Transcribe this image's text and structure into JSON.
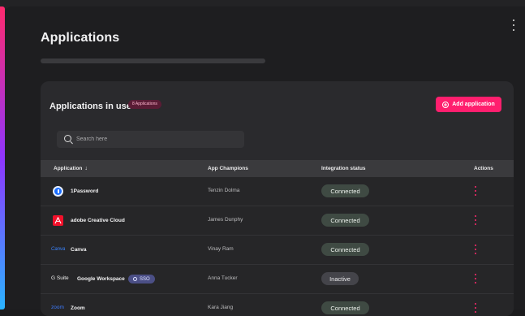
{
  "page": {
    "title": "Applications"
  },
  "card": {
    "title": "Applications in use",
    "count_label": "8 Applications",
    "add_button": "Add application"
  },
  "search": {
    "placeholder": "Search here"
  },
  "table": {
    "columns": [
      "Application",
      "App Champions",
      "Integration status",
      "Actions"
    ],
    "rows": [
      {
        "name": "1Password",
        "champion": "Tenzin Dolma",
        "status": "Connected",
        "icon": "1password-logo",
        "logo_text": ""
      },
      {
        "name": "adobe Creative Cloud",
        "champion": "James Dunphy",
        "status": "Connected",
        "icon": "adobe-logo",
        "logo_text": ""
      },
      {
        "name": "Canva",
        "champion": "Vinay Ram",
        "status": "Connected",
        "icon": "canva-logo",
        "logo_text": "Canva"
      },
      {
        "name": "Google Workspace",
        "champion": "Anna Tucker",
        "status": "Inactive",
        "icon": "gsuite-logo",
        "logo_text": "G Suite",
        "tag": "SSO"
      },
      {
        "name": "Zoom",
        "champion": "Kara Jiang",
        "status": "Connected",
        "icon": "zoom-logo",
        "logo_text": "zoom"
      }
    ]
  },
  "colors": {
    "accent": "#ff1f6e",
    "connected_bg": "#3f4a43",
    "inactive_bg": "#44444a"
  }
}
